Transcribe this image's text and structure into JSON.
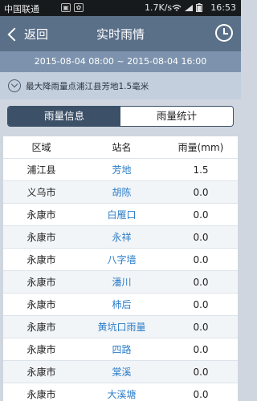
{
  "status_bar": {
    "carrier": "中国联通",
    "net_speed": "1.7K/s",
    "time": "16:53"
  },
  "header": {
    "back_label": "返回",
    "title": "实时雨情"
  },
  "date_range": "2015-08-04 08:00 ~ 2015-08-04 16:00",
  "max_rain_text": "最大降雨量点浦江县芳地1.5毫米",
  "tabs": [
    {
      "label": "雨量信息",
      "active": true
    },
    {
      "label": "雨量统计",
      "active": false
    }
  ],
  "table": {
    "columns": [
      "区域",
      "站名",
      "雨量(mm)"
    ],
    "rows": [
      [
        "浦江县",
        "芳地",
        "1.5"
      ],
      [
        "义乌市",
        "胡陈",
        "0.0"
      ],
      [
        "永康市",
        "白雁口",
        "0.0"
      ],
      [
        "永康市",
        "永祥",
        "0.0"
      ],
      [
        "永康市",
        "八字墙",
        "0.0"
      ],
      [
        "永康市",
        "潘川",
        "0.0"
      ],
      [
        "永康市",
        "柿后",
        "0.0"
      ],
      [
        "永康市",
        "黄坑口雨量",
        "0.0"
      ],
      [
        "永康市",
        "四路",
        "0.0"
      ],
      [
        "永康市",
        "棠溪",
        "0.0"
      ],
      [
        "永康市",
        "大溪塘",
        "0.0"
      ]
    ]
  }
}
